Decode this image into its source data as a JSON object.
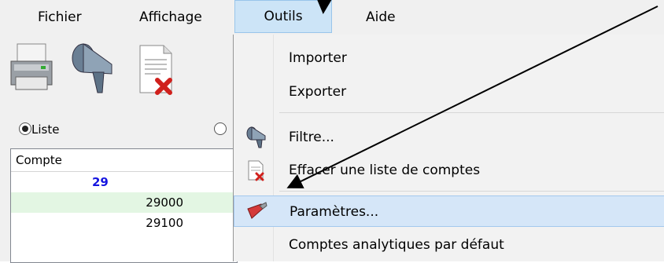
{
  "menubar": {
    "items": [
      {
        "label": "Fichier"
      },
      {
        "label": "Affichage"
      },
      {
        "label": "Outils"
      },
      {
        "label": "Aide"
      }
    ]
  },
  "toolbar": {
    "icons": [
      "printer-icon",
      "filter-funnel-icon",
      "delete-document-icon"
    ]
  },
  "view_options": {
    "liste_label": "Liste"
  },
  "accounts_list": {
    "header": "Compte",
    "rows": [
      {
        "value": "29"
      },
      {
        "value": "29000"
      },
      {
        "value": "29100"
      }
    ]
  },
  "outils_menu": {
    "items": [
      {
        "label": "Importer"
      },
      {
        "label": "Exporter"
      },
      {
        "label": "Filtre..."
      },
      {
        "label": "Effacer une liste de comptes"
      },
      {
        "label": "Paramètres..."
      },
      {
        "label": "Comptes analytiques par défaut"
      }
    ]
  },
  "colors": {
    "highlight": "#cce4f7",
    "account_group": "#1515e0",
    "row_alt": "#e3f6e3"
  }
}
